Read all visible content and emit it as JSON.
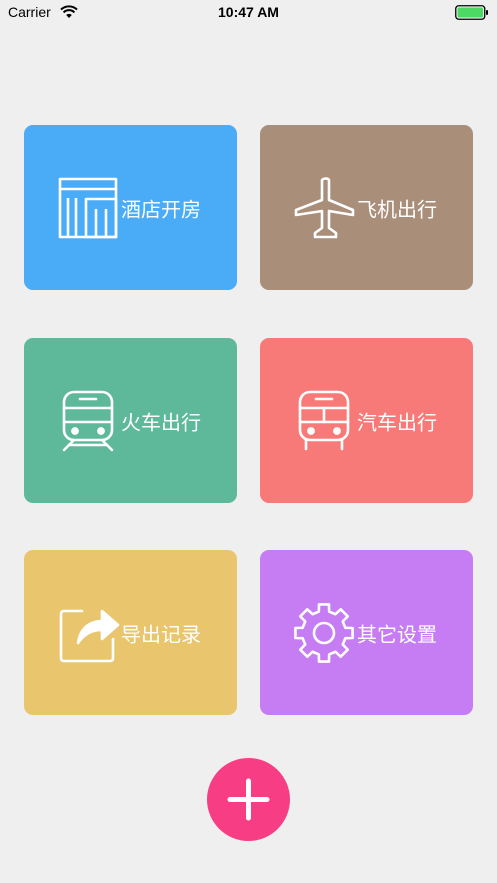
{
  "status_bar": {
    "carrier": "Carrier",
    "time": "10:47 AM",
    "battery_level": 1.0
  },
  "tiles": [
    {
      "label": "酒店开房",
      "icon": "hotel-building-icon",
      "color": "#4AABF7"
    },
    {
      "label": "飞机出行",
      "icon": "airplane-icon",
      "color": "#A98E7A"
    },
    {
      "label": "火车出行",
      "icon": "train-icon",
      "color": "#5DB99A"
    },
    {
      "label": "汽车出行",
      "icon": "bus-icon",
      "color": "#F77A78"
    },
    {
      "label": "导出记录",
      "icon": "export-share-icon",
      "color": "#E9C66E"
    },
    {
      "label": "其它设置",
      "icon": "gear-icon",
      "color": "#C67CF2"
    }
  ],
  "fab": {
    "icon": "plus-icon",
    "color": "#F73E85"
  }
}
